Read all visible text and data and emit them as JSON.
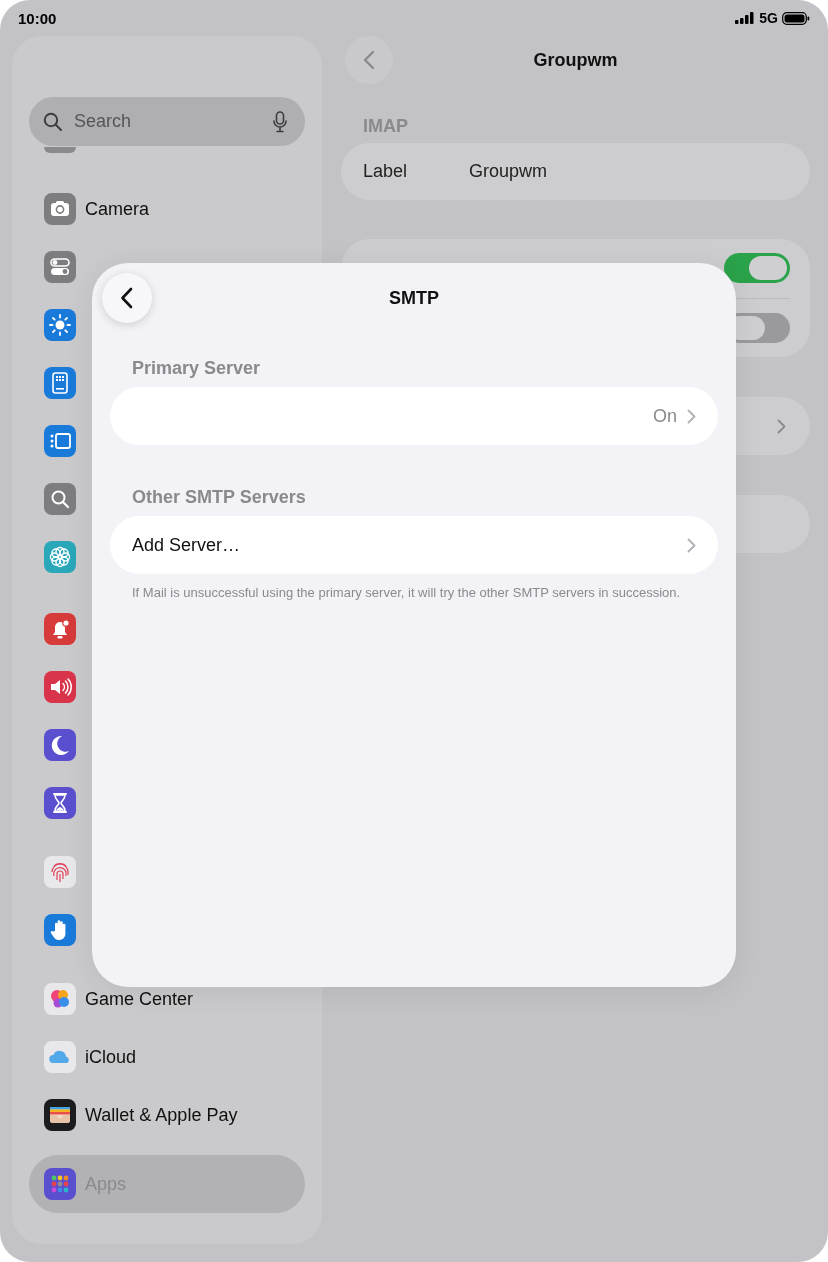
{
  "status_bar": {
    "time": "10:00",
    "network": "5G"
  },
  "sidebar": {
    "search": {
      "placeholder": "Search"
    },
    "groups": [
      [
        {
          "label": "Camera",
          "kind": "camera",
          "color": "#7d7d80",
          "selected": false
        },
        {
          "kind": "switches",
          "color": "#7d7d80",
          "selected": false
        },
        {
          "kind": "sun",
          "color": "#1a7ad9",
          "selected": false
        },
        {
          "kind": "screen",
          "color": "#1a7ad9",
          "selected": false
        },
        {
          "kind": "dock",
          "color": "#1a7ad9",
          "selected": false
        },
        {
          "kind": "search",
          "color": "#7d7d80",
          "selected": false
        },
        {
          "kind": "flower",
          "color": "#2aa7b8",
          "selected": false
        }
      ],
      [
        {
          "kind": "bell",
          "color": "#d63a3a",
          "selected": false
        },
        {
          "kind": "speaker",
          "color": "#d8344a",
          "selected": false
        },
        {
          "kind": "moon",
          "color": "#5a4fcf",
          "selected": false
        },
        {
          "kind": "hourglass",
          "color": "#5a4fcf",
          "selected": false
        }
      ],
      [
        {
          "kind": "fingerprint",
          "color": "#e8e8ea",
          "selected": false
        },
        {
          "kind": "hand",
          "color": "#1a7ad9",
          "selected": false
        }
      ],
      [
        {
          "label": "Game Center",
          "kind": "bubbles",
          "color": "#e8e8ea",
          "selected": false
        },
        {
          "label": "iCloud",
          "kind": "cloud",
          "color": "#e8e8ea",
          "selected": false
        },
        {
          "label": "Wallet & Apple Pay",
          "kind": "wallet",
          "color": "#1c1c1e",
          "selected": false
        }
      ],
      [
        {
          "label": "Apps",
          "kind": "grid",
          "color": "#5a4fcf",
          "selected": true
        }
      ]
    ]
  },
  "detail": {
    "title": "Groupwm",
    "header": "IMAP",
    "label_row": {
      "label": "Label",
      "value": "Groupwm"
    },
    "switches": [
      {
        "on": true
      },
      {
        "on": false
      }
    ]
  },
  "sheet": {
    "title": "SMTP",
    "sections": [
      {
        "header": "Primary Server",
        "rows": [
          {
            "value": "On"
          }
        ]
      },
      {
        "header": "Other SMTP Servers",
        "rows": [
          {
            "label": "Add Server…"
          }
        ],
        "footer": "If Mail is unsuccessful using the primary server, it will try the other SMTP servers in succession."
      }
    ]
  }
}
